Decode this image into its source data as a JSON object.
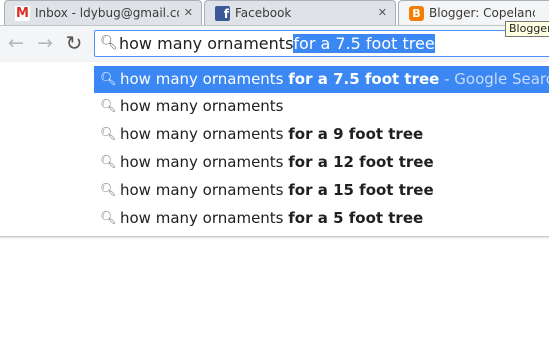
{
  "tabs": [
    {
      "title": "Inbox - ldybug@gmail.com",
      "favicon": "gmail-icon",
      "close": "✕"
    },
    {
      "title": "Facebook",
      "favicon": "facebook-icon",
      "close": "✕"
    },
    {
      "title": "Blogger: Copeland Christmas",
      "favicon": "blogger-icon"
    }
  ],
  "tooltip": "Blogger",
  "toolbar": {
    "back": "←",
    "forward": "→",
    "reload": "↻"
  },
  "omnibox": {
    "typed": "how many ornaments",
    "autocomplete": "for a 7.5 foot tree"
  },
  "suggestions": [
    {
      "prefix": "how many ornaments",
      "bold": "for a 7.5 foot tree",
      "hint": "- Google Search",
      "selected": true
    },
    {
      "prefix": "how many ornaments",
      "bold": "",
      "hint": ""
    },
    {
      "prefix": "how many ornaments",
      "bold": "for a 9 foot tree",
      "hint": ""
    },
    {
      "prefix": "how many ornaments",
      "bold": "for a 12 foot tree",
      "hint": ""
    },
    {
      "prefix": "how many ornaments",
      "bold": "for a 15 foot tree",
      "hint": ""
    },
    {
      "prefix": "how many ornaments",
      "bold": "for a 5 foot tree",
      "hint": ""
    }
  ],
  "colors": {
    "accent": "#3b87f3",
    "focus_border": "#4d90fe"
  }
}
